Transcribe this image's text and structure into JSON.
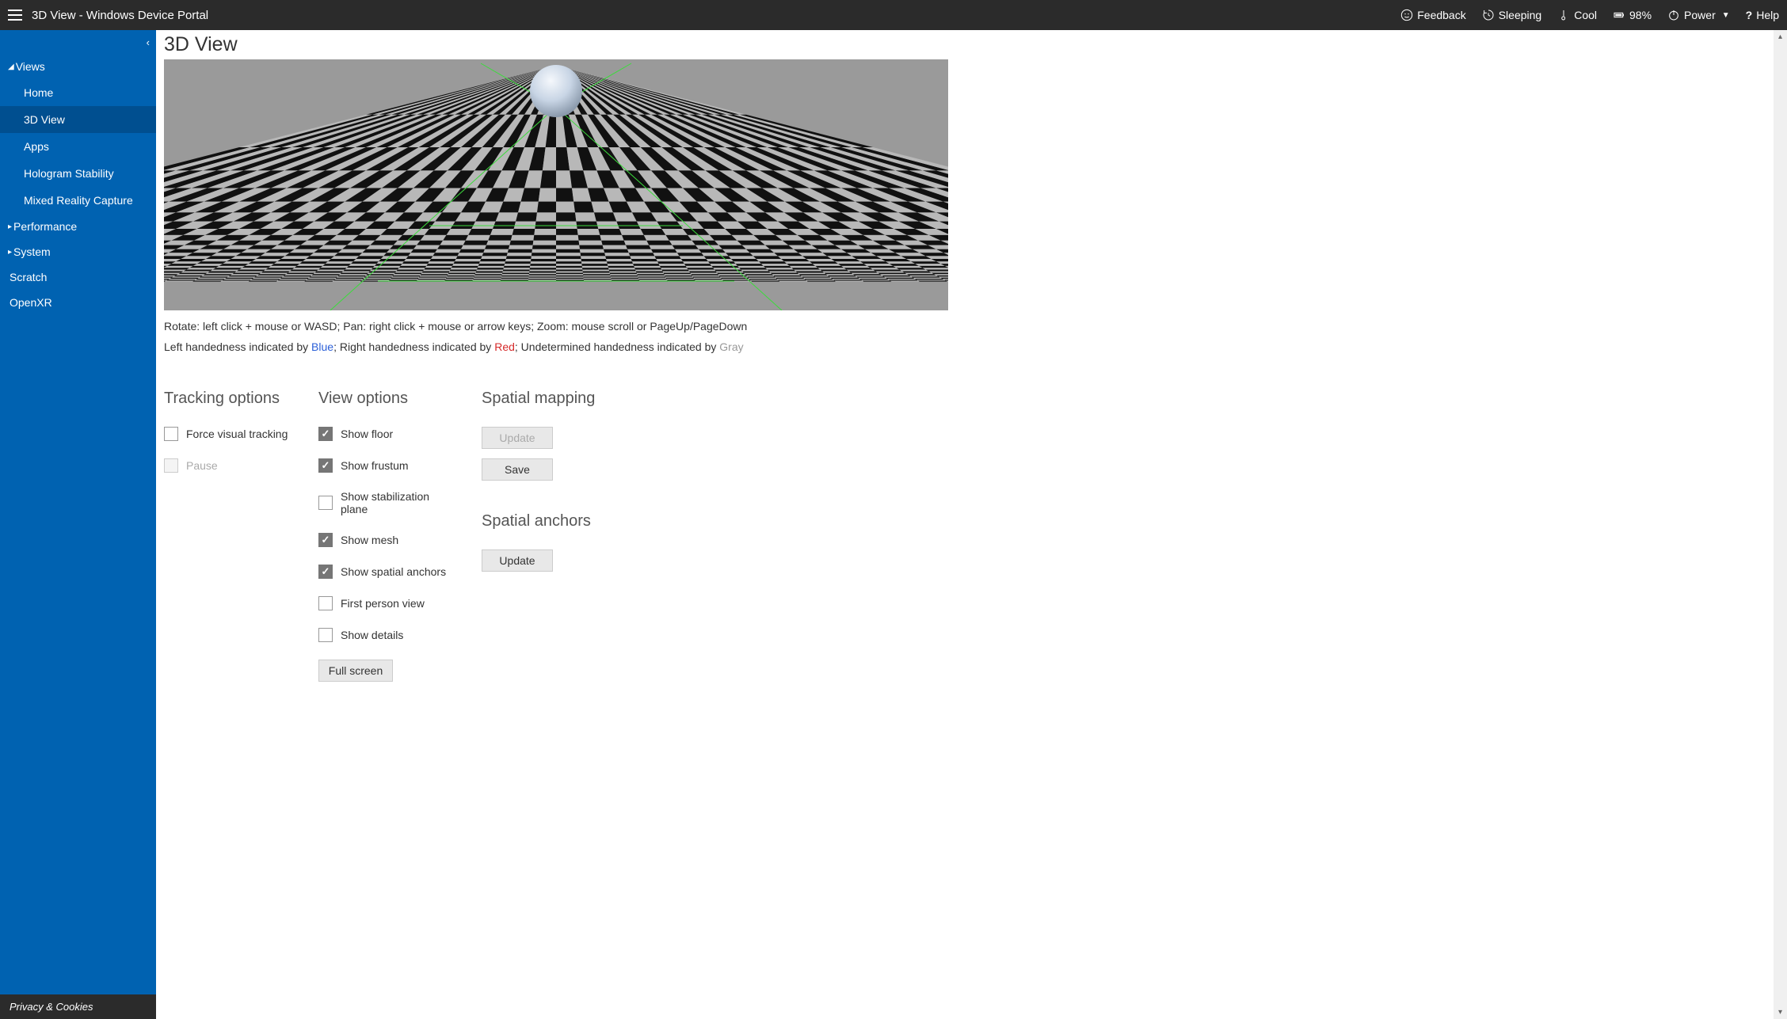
{
  "header": {
    "title": "3D View - Windows Device Portal",
    "feedback": "Feedback",
    "sleeping": "Sleeping",
    "cool": "Cool",
    "battery": "98%",
    "power": "Power",
    "help": "Help"
  },
  "sidebar": {
    "groups": [
      {
        "label": "Views",
        "expanded": true
      },
      {
        "label": "Performance",
        "expanded": false
      },
      {
        "label": "System",
        "expanded": false
      }
    ],
    "views_items": [
      {
        "label": "Home"
      },
      {
        "label": "3D View",
        "active": true
      },
      {
        "label": "Apps"
      },
      {
        "label": "Hologram Stability"
      },
      {
        "label": "Mixed Reality Capture"
      }
    ],
    "top_items": [
      {
        "label": "Scratch"
      },
      {
        "label": "OpenXR"
      }
    ],
    "footer": "Privacy & Cookies"
  },
  "page": {
    "title": "3D View",
    "help1": "Rotate: left click + mouse or WASD; Pan: right click + mouse or arrow keys; Zoom: mouse scroll or PageUp/PageDown",
    "help2_prefix": "Left handedness indicated by ",
    "help2_blue": "Blue",
    "help2_mid": "; Right handedness indicated by ",
    "help2_red": "Red",
    "help2_mid2": "; Undetermined handedness indicated by ",
    "help2_gray": "Gray"
  },
  "tracking": {
    "heading": "Tracking options",
    "force": "Force visual tracking",
    "pause": "Pause"
  },
  "view": {
    "heading": "View options",
    "floor": "Show floor",
    "frustum": "Show frustum",
    "stab": "Show stabilization plane",
    "mesh": "Show mesh",
    "anchors": "Show spatial anchors",
    "fpv": "First person view",
    "details": "Show details",
    "fullscreen": "Full screen"
  },
  "spatial_mapping": {
    "heading": "Spatial mapping",
    "update": "Update",
    "save": "Save"
  },
  "spatial_anchors": {
    "heading": "Spatial anchors",
    "update": "Update"
  }
}
